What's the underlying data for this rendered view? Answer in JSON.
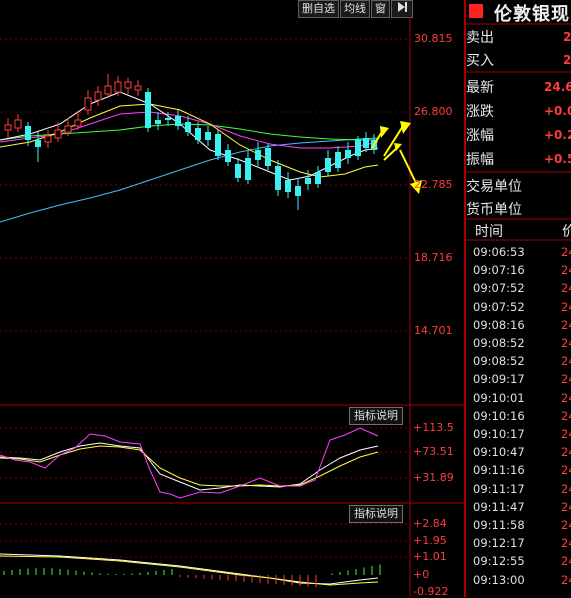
{
  "toolbar": {
    "delete_label": "删自选",
    "ma_label": "均线",
    "window_label": "窗",
    "pin_icon": "pin-icon"
  },
  "price_scale": [
    "30.815",
    "26.800",
    "22.785",
    "18.716",
    "14.701"
  ],
  "panel1": {
    "button": "指标说明",
    "scale": [
      "+113.5",
      "+73.51",
      "+31.89"
    ]
  },
  "panel2": {
    "button": "指标说明",
    "scale": [
      "+2.84",
      "+1.95",
      "+1.01",
      "+0",
      "-0.922"
    ]
  },
  "right_panel": {
    "title": "伦敦银现",
    "rows": [
      {
        "label": "卖出",
        "value": "2"
      },
      {
        "label": "买入",
        "value": "2"
      },
      {
        "label": "最新",
        "value": "24.6"
      },
      {
        "label": "涨跌",
        "value": "+0.0"
      },
      {
        "label": "涨幅",
        "value": "+0.2"
      },
      {
        "label": "振幅",
        "value": "+0.5"
      },
      {
        "label": "交易单位",
        "value": ""
      },
      {
        "label": "货币单位",
        "value": ""
      }
    ],
    "trade_header": {
      "time": "时间",
      "price": "价"
    },
    "trades": [
      {
        "time": "09:06:53",
        "price": "24"
      },
      {
        "time": "09:07:16",
        "price": "24"
      },
      {
        "time": "09:07:52",
        "price": "24"
      },
      {
        "time": "09:07:52",
        "price": "24"
      },
      {
        "time": "09:08:16",
        "price": "24"
      },
      {
        "time": "09:08:52",
        "price": "24"
      },
      {
        "time": "09:08:52",
        "price": "24"
      },
      {
        "time": "09:09:17",
        "price": "24"
      },
      {
        "time": "09:10:01",
        "price": "24"
      },
      {
        "time": "09:10:16",
        "price": "24"
      },
      {
        "time": "09:10:17",
        "price": "24"
      },
      {
        "time": "09:10:47",
        "price": "24"
      },
      {
        "time": "09:11:16",
        "price": "24"
      },
      {
        "time": "09:11:17",
        "price": "24"
      },
      {
        "time": "09:11:47",
        "price": "24"
      },
      {
        "time": "09:11:58",
        "price": "24"
      },
      {
        "time": "09:12:17",
        "price": "24"
      },
      {
        "time": "09:12:55",
        "price": "24"
      },
      {
        "time": "09:13:00",
        "price": "24"
      }
    ]
  },
  "colors": {
    "up": "#ff3c3c",
    "down": "#3cf0f0",
    "ma5": "#ffffff",
    "ma10": "#ffff40",
    "ma20": "#ff40ff",
    "ma30": "#40ff40",
    "ma60": "#40c0ff",
    "arrow": "#ffff00",
    "grid": "#8b0000"
  }
}
